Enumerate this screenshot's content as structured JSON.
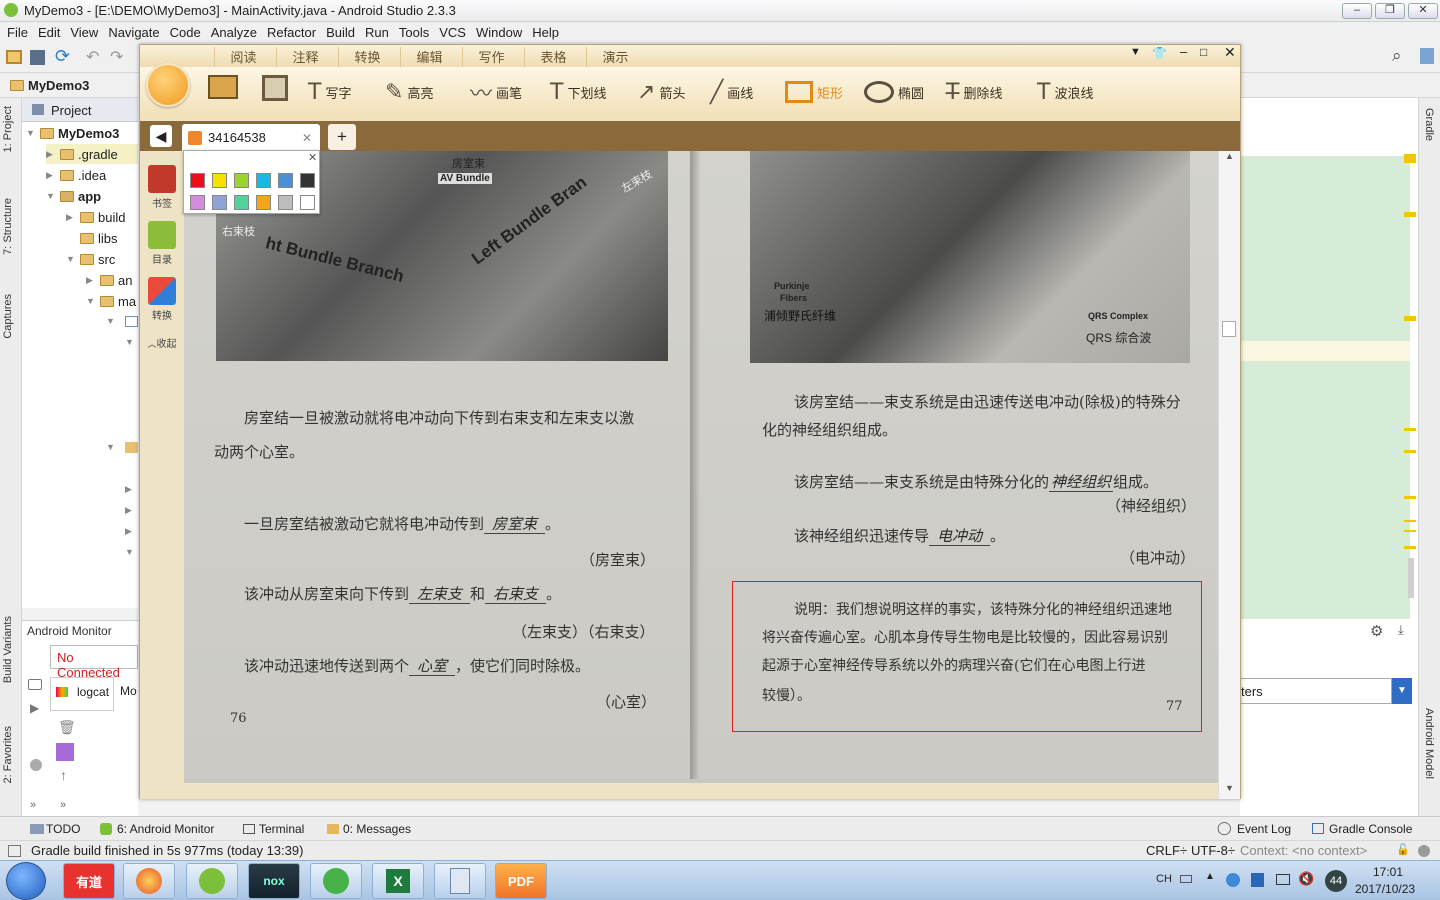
{
  "as": {
    "title": "MyDemo3 - [E:\\DEMO\\MyDemo3] - MainActivity.java - Android Studio 2.3.3",
    "menu": [
      "File",
      "Edit",
      "View",
      "Navigate",
      "Code",
      "Analyze",
      "Refactor",
      "Build",
      "Run",
      "Tools",
      "VCS",
      "Window",
      "Help"
    ],
    "crumb": "MyDemo3",
    "project_tab": "Project",
    "tree": {
      "root": "MyDemo3",
      "gradle": ".gradle",
      "idea": ".idea",
      "app": "app",
      "build": "build",
      "libs": "libs",
      "src": "src",
      "an": "an",
      "ma": "ma"
    },
    "side_tabs": {
      "project": "1: Project",
      "structure": "7: Structure",
      "captures": "Captures",
      "variants": "Build Variants",
      "favorites": "2: Favorites",
      "gradle": "Gradle",
      "android_model": "Android Model"
    },
    "monitor": {
      "title": "Android Monitor",
      "device": "No Connected",
      "logcat": "logcat",
      "monitors": "Mo",
      "filters": "ters"
    },
    "bottom_tabs": {
      "todo": "TODO",
      "monitor": "6: Android Monitor",
      "terminal": "Terminal",
      "messages": "0: Messages",
      "event_log": "Event Log",
      "gradle_console": "Gradle Console"
    },
    "status": {
      "msg": "Gradle build finished in 5s 977ms (today 13:39)",
      "crlf": "CRLF÷",
      "enc": "UTF-8÷",
      "ctx": "Context: <no context>"
    }
  },
  "taskbar": {
    "apps": [
      "有道",
      "Firefox",
      "Android Studio",
      "nox",
      "Sync",
      "Excel",
      "Calculator",
      "PDF"
    ],
    "ime": "CH",
    "badge": "44",
    "time": "17:01",
    "date": "2017/10/23"
  },
  "reader": {
    "mode_tabs": [
      "阅读",
      "注释",
      "转换",
      "编辑",
      "写作",
      "表格",
      "演示"
    ],
    "tools": [
      "写字",
      "高亮",
      "画笔",
      "下划线",
      "箭头",
      "画线",
      "矩形",
      "椭圆",
      "删除线",
      "波浪线"
    ],
    "doc_tab": "34164538",
    "side": {
      "bookmark": "书签",
      "toc": "目录",
      "convert": "转换",
      "collapse": "收起"
    },
    "palette_colors": [
      "#e8101a",
      "#f5e100",
      "#9bd42a",
      "#1cb7e6",
      "#4a8fd8",
      "#333333",
      "#d58be0",
      "#8ea3d8",
      "#4fd39a",
      "#f3a51b",
      "#bdbdbd",
      "#ffffff"
    ]
  },
  "page_left": {
    "fig_labels": {
      "av_cn": "房室束",
      "av_en": "AV Bundle",
      "right_cn": "右束枝",
      "right_en": "ht Bundle Branch",
      "left_en": "Left Bundle Bran",
      "left_cn": "左束枝"
    },
    "p1a": "房室结一旦被激动就将电冲动向下传到右束支和左束支以激",
    "p1b": "动两个心室。",
    "q1_pre": "一旦房室结被激动它就将电冲动传到",
    "q1_hand": "房室束",
    "q1_post": "。",
    "a1": "（房室束）",
    "q2_pre": "该冲动从房室束向下传到",
    "q2_hand1": "左束支",
    "q2_mid": "和",
    "q2_hand2": "右束支",
    "q2_post": "。",
    "a2": "（左束支）（右束支）",
    "q3_pre": "该冲动迅速地传送到两个",
    "q3_hand": "心室",
    "q3_post": "，使它们同时除极。",
    "a3": "（心室）",
    "page_no": "76"
  },
  "page_right": {
    "fig_labels": {
      "purkinje": "Purkinje",
      "fibers": "Fibers",
      "purkinje_cn": "浦倾野氏纤维",
      "qrs_en": "QRS Complex",
      "qrs_cn": "QRS 综合波"
    },
    "p1a": "该房室结——束支系统是由迅速传送电冲动(除极)的特殊分",
    "p1b": "化的神经组织组成。",
    "q1_pre": "该房室结——束支系统是由特殊分化的",
    "q1_hand": "神经组织",
    "q1_post": "组成。",
    "a1": "（神经组织）",
    "q2_pre": "该神经组织迅速传导",
    "q2_hand": "电冲动",
    "q2_post": "。",
    "a2": "（电冲动）",
    "note1": "说明：我们想说明这样的事实，该特殊分化的神经组织迅速地",
    "note2": "将兴奋传遍心室。心肌本身传导生物电是比较慢的，因此容易识别",
    "note3": "起源于心室神经传导系统以外的病理兴奋(它们在心电图上行进",
    "note4": "较慢）。",
    "page_no": "77"
  }
}
